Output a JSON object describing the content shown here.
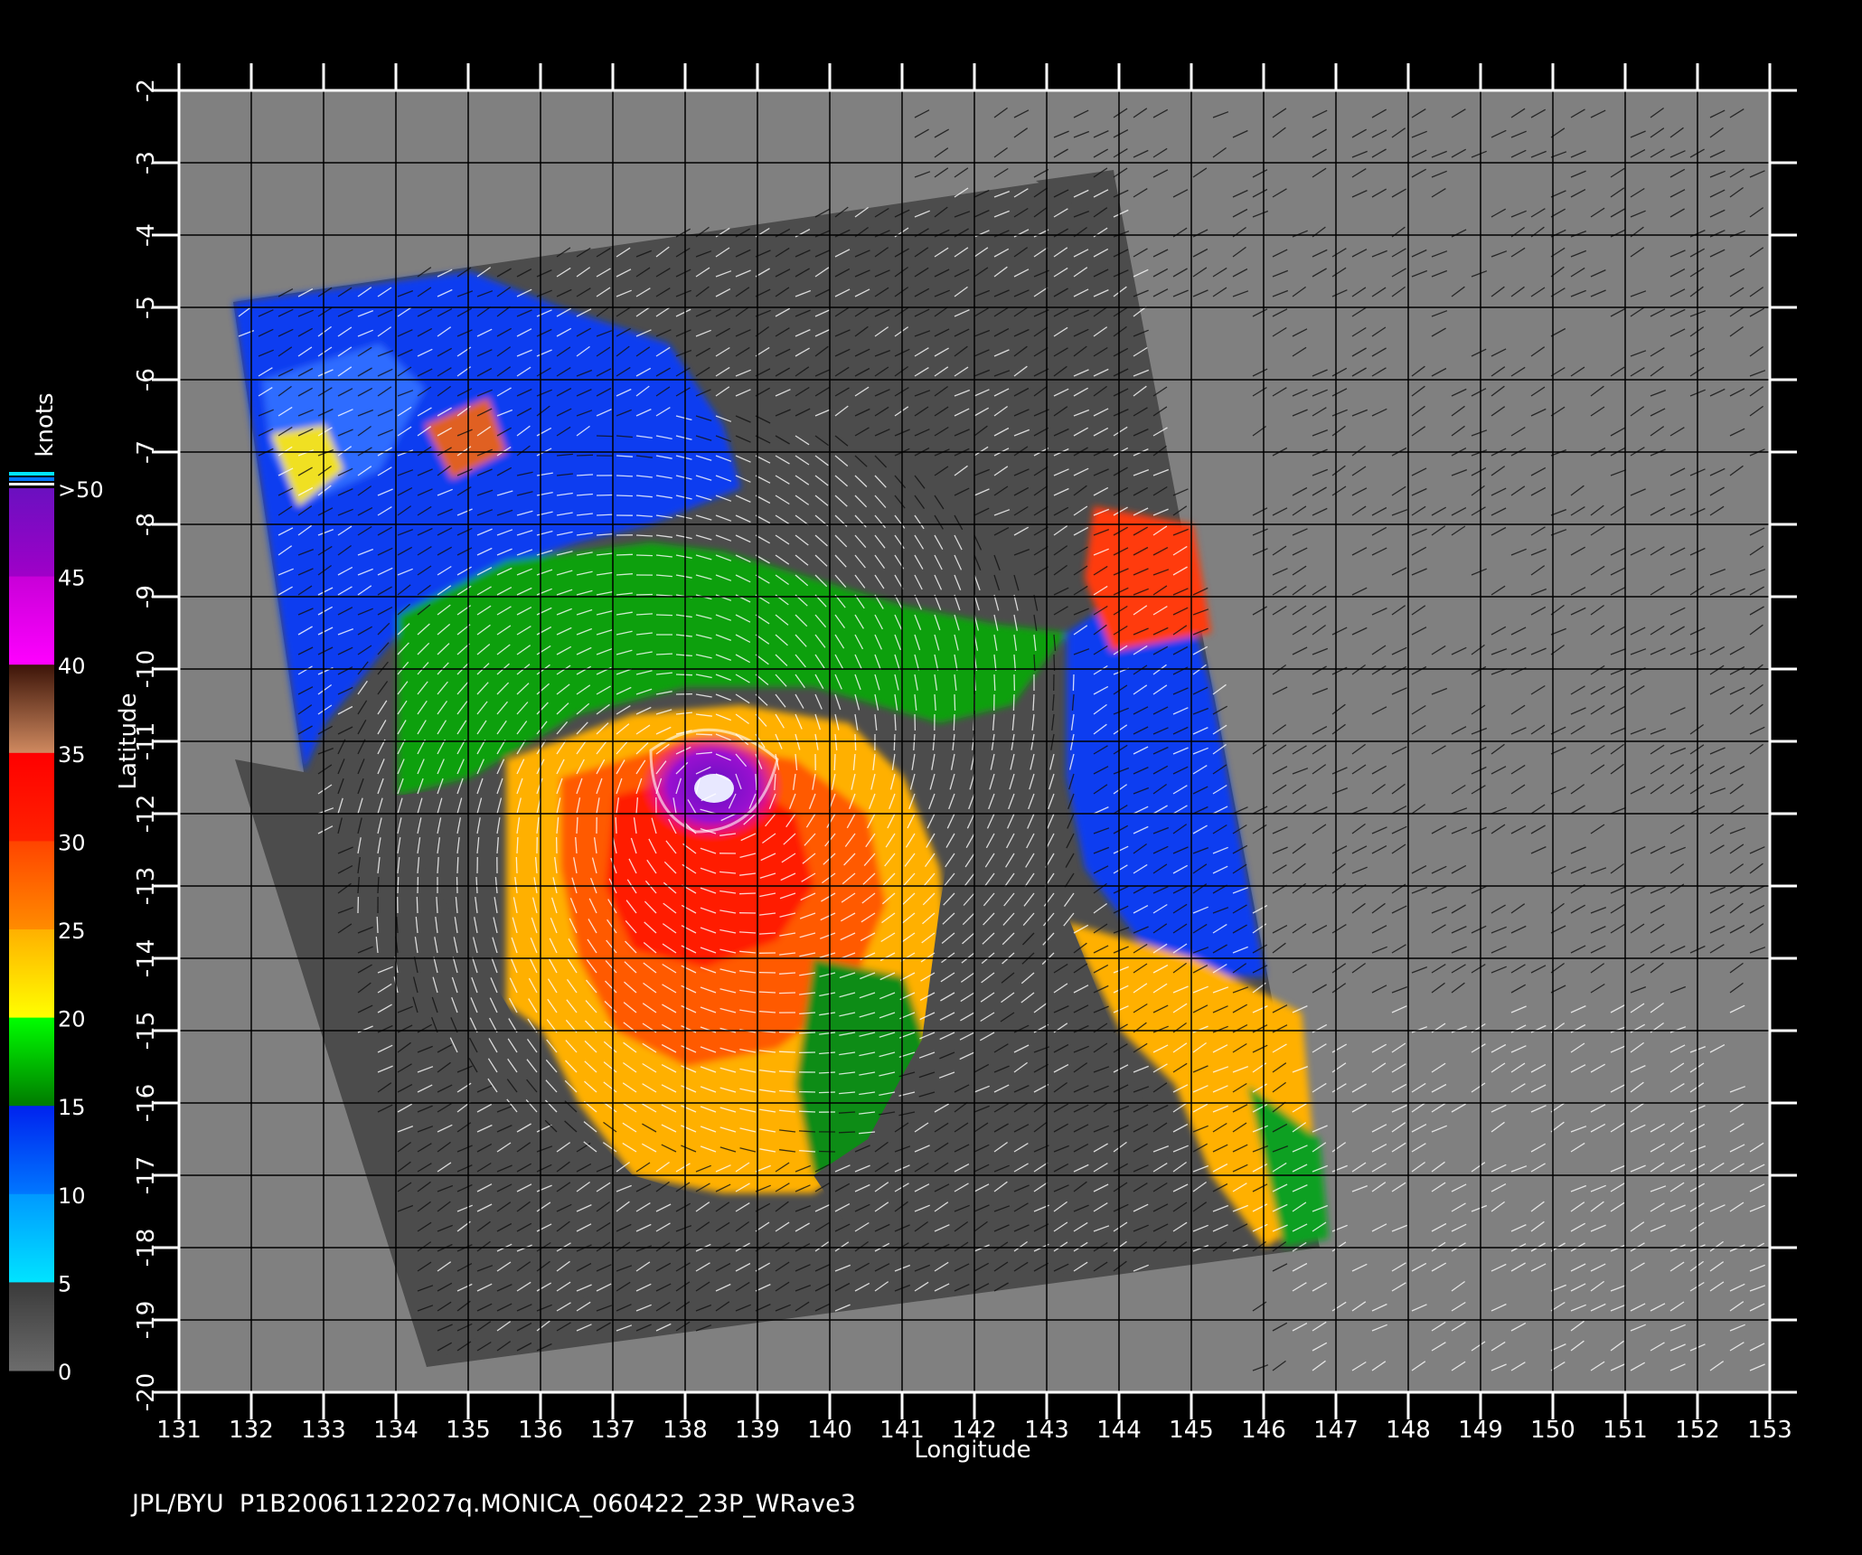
{
  "map": {
    "x_axis_label": "Longitude",
    "y_axis_label": "Latitude",
    "lon_ticks": [
      131,
      132,
      133,
      134,
      135,
      136,
      137,
      138,
      139,
      140,
      141,
      142,
      143,
      144,
      145,
      146,
      147,
      148,
      149,
      150,
      151,
      152,
      153
    ],
    "lat_ticks": [
      -2,
      -3,
      -4,
      -5,
      -6,
      -7,
      -8,
      -9,
      -10,
      -11,
      -12,
      -13,
      -14,
      -15,
      -16,
      -17,
      -18,
      -19,
      -20
    ],
    "lon_range": [
      131,
      153
    ],
    "lat_range": [
      -2,
      -20
    ],
    "storm_center": {
      "lon": 138.4,
      "lat": -11.7
    },
    "colors": {
      "frame_bg": "#000000",
      "outside_swath": "#808080",
      "land_in_swath": "#4c4c4c",
      "grid": "#000000"
    }
  },
  "legend": {
    "unit": "knots",
    "tick_labels": [
      ">50",
      "45",
      "40",
      "35",
      "30",
      "25",
      "20",
      "15",
      "10",
      "5",
      "0"
    ],
    "bands": [
      {
        "from": 0,
        "to": 5,
        "colors": [
          "#6c6c6c",
          "#3a3a3a"
        ]
      },
      {
        "from": 5,
        "to": 10,
        "colors": [
          "#00e4ff",
          "#0099ff"
        ]
      },
      {
        "from": 10,
        "to": 15,
        "colors": [
          "#0077ff",
          "#0022ee"
        ]
      },
      {
        "from": 15,
        "to": 20,
        "colors": [
          "#007a00",
          "#00ff00"
        ]
      },
      {
        "from": 20,
        "to": 25,
        "colors": [
          "#ffff00",
          "#ffb000"
        ]
      },
      {
        "from": 25,
        "to": 30,
        "colors": [
          "#ff8c00",
          "#ff4400"
        ]
      },
      {
        "from": 30,
        "to": 35,
        "colors": [
          "#ff2200",
          "#ff0000"
        ]
      },
      {
        "from": 35,
        "to": 40,
        "colors": [
          "#d08a60",
          "#3c1408"
        ]
      },
      {
        "from": 40,
        "to": 45,
        "colors": [
          "#ff00ff",
          "#c800d8"
        ]
      },
      {
        "from": 45,
        "to": 50,
        "colors": [
          "#a000c8",
          "#6a10c0"
        ]
      }
    ]
  },
  "footer": {
    "product_label": "JPL/BYU  P1B20061122027q.MONICA_060422_23P_WRave3"
  }
}
